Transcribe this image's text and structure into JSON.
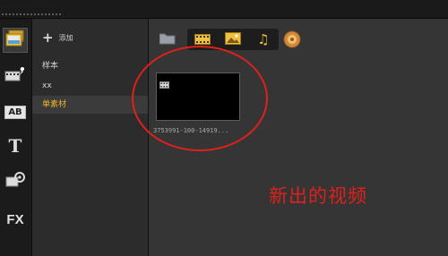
{
  "window": {
    "accent_color": "#f0b429",
    "annotation_color": "#e0201c"
  },
  "rail": {
    "items": [
      {
        "icon": "media-library-icon",
        "active": true
      },
      {
        "icon": "transition-icon"
      },
      {
        "icon": "title-ab-icon",
        "text": "AB"
      },
      {
        "icon": "text-t-icon",
        "text": "T"
      },
      {
        "icon": "graphics-icon"
      },
      {
        "icon": "fx-filter-icon",
        "text": "FX"
      }
    ]
  },
  "library": {
    "add_label": "添加",
    "items": [
      {
        "label": "样本"
      },
      {
        "label": "xx"
      },
      {
        "label": "单素材",
        "selected": true
      }
    ]
  },
  "toolbar": {
    "icons": [
      "folder-icon",
      "video-filter-icon",
      "image-filter-icon",
      "audio-filter-icon",
      "sort-icon"
    ]
  },
  "media": {
    "clips": [
      {
        "filename": "3753991-100-14919...",
        "type": "video"
      }
    ]
  },
  "annotation": {
    "text": "新出的视频"
  }
}
